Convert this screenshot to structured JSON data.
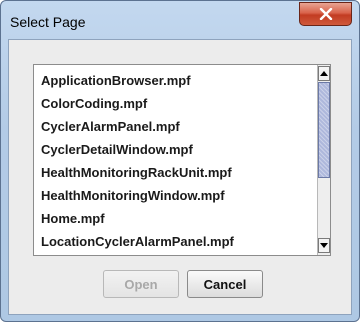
{
  "dialog": {
    "title": "Select Page",
    "close_icon": "close-x-icon",
    "close_color": "#c8452a"
  },
  "list": {
    "items": [
      "ApplicationBrowser.mpf",
      "ColorCoding.mpf",
      "CyclerAlarmPanel.mpf",
      "CyclerDetailWindow.mpf",
      "HealthMonitoringRackUnit.mpf",
      "HealthMonitoringWindow.mpf",
      "Home.mpf",
      "LocationCyclerAlarmPanel.mpf"
    ],
    "scroll_up_icon": "triangle-up-icon",
    "scroll_down_icon": "triangle-down-icon"
  },
  "buttons": {
    "open_label": "Open",
    "open_enabled": false,
    "cancel_label": "Cancel"
  }
}
